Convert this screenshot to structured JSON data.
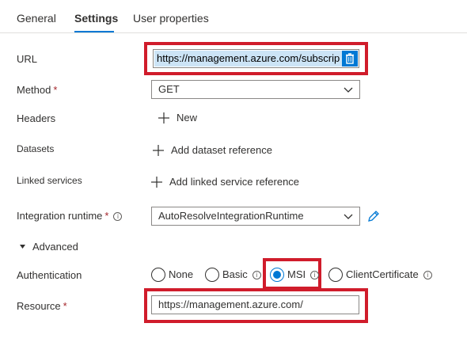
{
  "tabs": [
    {
      "label": "General"
    },
    {
      "label": "Settings"
    },
    {
      "label": "User properties"
    }
  ],
  "form": {
    "url": {
      "label": "URL",
      "value": "https://management.azure.com/subscrip"
    },
    "method": {
      "label": "Method",
      "required": "*",
      "value": "GET"
    },
    "headers": {
      "label": "Headers",
      "action": "New"
    },
    "datasets": {
      "label": "Datasets",
      "action": "Add dataset reference"
    },
    "linked_services": {
      "label": "Linked services",
      "action": "Add linked service reference"
    },
    "integration_runtime": {
      "label": "Integration runtime",
      "required": "*",
      "value": "AutoResolveIntegrationRuntime"
    },
    "advanced": {
      "label": "Advanced",
      "expanded": true
    },
    "authentication": {
      "label": "Authentication",
      "options": [
        {
          "label": "None",
          "selected": false
        },
        {
          "label": "Basic",
          "selected": false
        },
        {
          "label": "MSI",
          "selected": true
        },
        {
          "label": "ClientCertificate",
          "selected": false
        }
      ]
    },
    "resource": {
      "label": "Resource",
      "required": "*",
      "value": "https://management.azure.com/"
    }
  },
  "icons": {
    "trash": "trash-icon",
    "chevron": "chevron-down-icon",
    "plus": "plus-icon",
    "edit": "pencil-icon",
    "info": "info-icon",
    "caret": "caret-down-icon"
  },
  "colors": {
    "accent": "#0078d4",
    "highlight": "#d01c2b",
    "selection": "#cce4f6",
    "required": "#a4262c"
  }
}
